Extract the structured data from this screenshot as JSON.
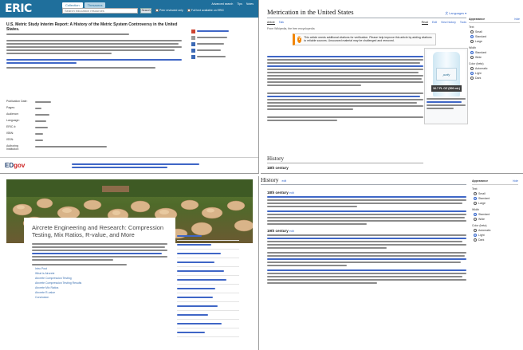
{
  "eric": {
    "logo": "ERIC",
    "tabs": [
      "Collection",
      "Thesaurus"
    ],
    "search_placeholder": "Search education resources",
    "search_button": "Search",
    "peer_reviewed_label": "Peer reviewed only",
    "fulltext_label": "Full text available on ERIC",
    "nav": [
      "Advanced search",
      "Tips",
      "Notes"
    ],
    "title": "U.S. Metric Study Interim Report: A History of the Metric System Controversy in the United States.",
    "meta_rows": [
      {
        "key": "Publication Date:"
      },
      {
        "key": "Pages:"
      },
      {
        "key": "Audience:"
      },
      {
        "key": "Language:"
      },
      {
        "key": "ERIC #:"
      },
      {
        "key": "ISBN:"
      },
      {
        "key": "ISSN:"
      },
      {
        "key": "Authoring Institution:"
      }
    ],
    "side_buttons": [
      "",
      "",
      "",
      "",
      ""
    ],
    "footer_logo": "ED",
    "footer_logo_suffix": "gov"
  },
  "wiki1": {
    "title": "Metrication in the United States",
    "languages": "Languages",
    "tabs": [
      "Article",
      "Talk",
      "Read",
      "Edit",
      "View history",
      "Tools"
    ],
    "from_line": "From Wikipedia, the free encyclopedia",
    "ambox_text": "This article needs additional citations for verification. Please help improve this article by adding citations to reliable sources. Unsourced material may be challenged and removed.",
    "image_caption_large": "16.7 FL OZ (500 mL)",
    "image_brand": "purity",
    "section_history": "History",
    "section_18th": "18th century",
    "appearance": {
      "title": "Appearance",
      "hide": "hide",
      "text_label": "Text",
      "text_options": [
        "Small",
        "Standard",
        "Large"
      ],
      "text_selected": 1,
      "width_label": "Width",
      "width_options": [
        "Standard",
        "Wide"
      ],
      "width_selected": 0,
      "color_label": "Color (beta)",
      "color_options": [
        "Automatic",
        "Light",
        "Dark"
      ],
      "color_selected": 1
    }
  },
  "blog": {
    "title": "Aircrete Engineering and Research: Compression Testing, Mix Ratios, R-value, and More",
    "toc": [
      "Intro Post",
      "What is Aircrete",
      "Aircrete Compression Testing",
      "Aircrete Compression Testing Results",
      "Aircrete Mix Ratios",
      "Aircrete R-value",
      "Conclusion"
    ],
    "side_items": [
      "",
      "",
      "",
      "",
      "",
      "",
      "",
      "",
      "",
      "",
      "",
      ""
    ]
  },
  "wiki2": {
    "section_history": "History",
    "edit": "edit",
    "section_18th": "18th century",
    "section_19th": "19th century",
    "appearance": {
      "title": "Appearance",
      "hide": "hide",
      "text_label": "Text",
      "text_options": [
        "Small",
        "Standard",
        "Large"
      ],
      "text_selected": 1,
      "width_label": "Width",
      "width_options": [
        "Standard",
        "Wide"
      ],
      "width_selected": 0,
      "color_label": "Color (beta)",
      "color_options": [
        "Automatic",
        "Light",
        "Dark"
      ],
      "color_selected": 1
    }
  }
}
